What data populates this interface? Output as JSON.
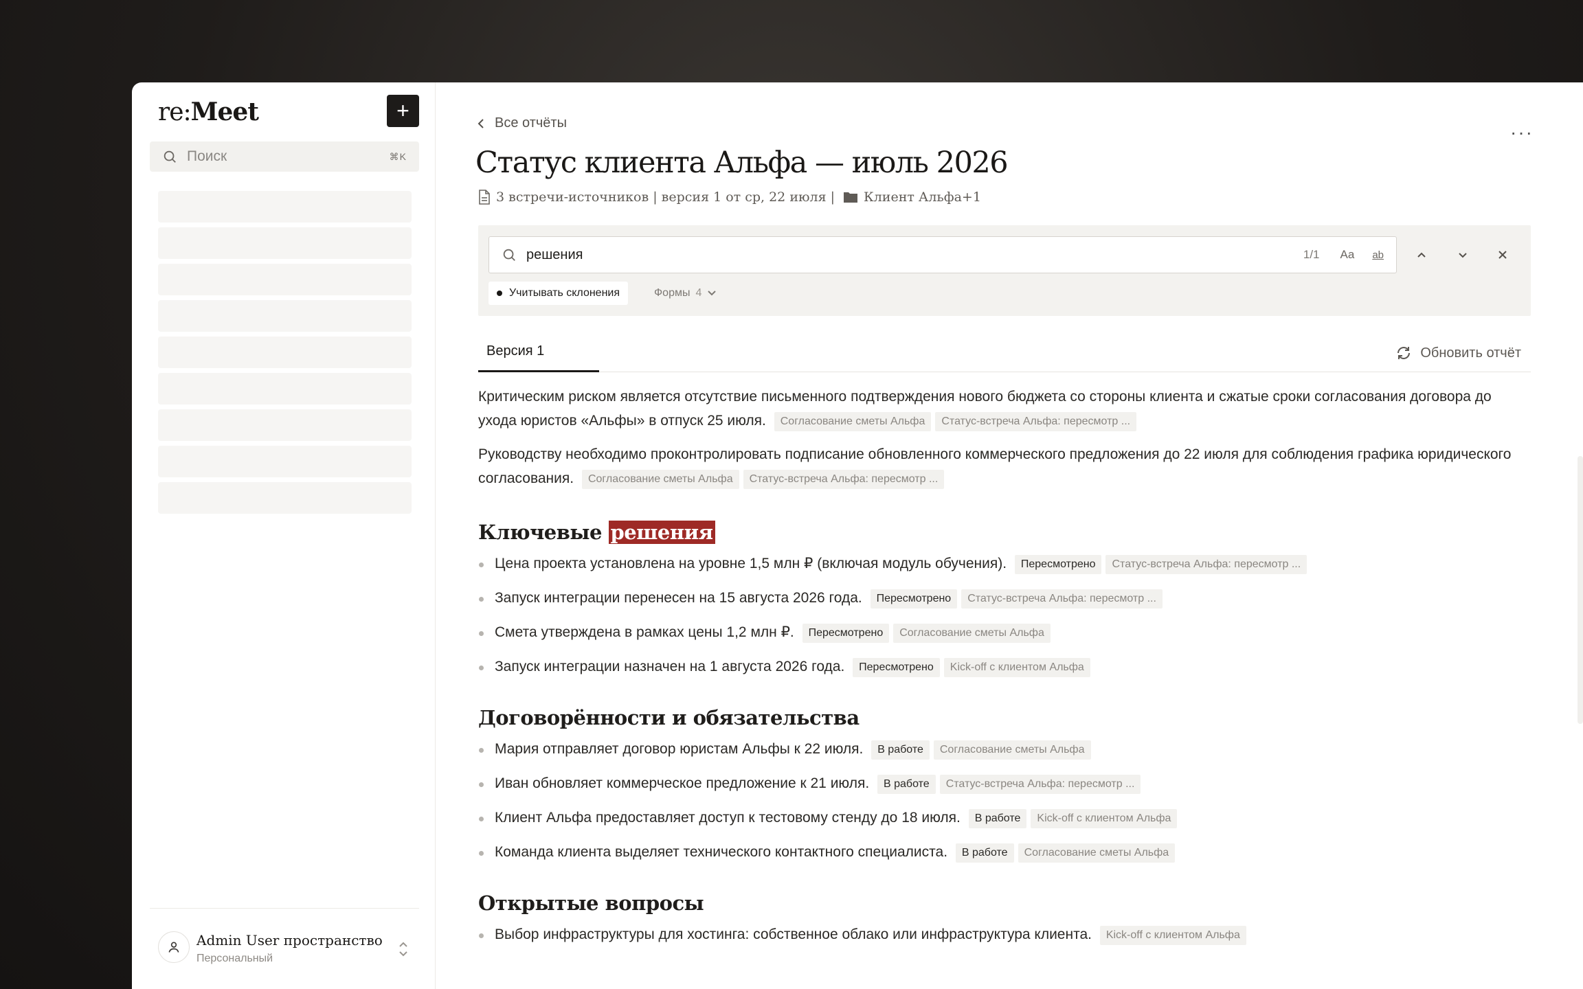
{
  "sidebar": {
    "logo_prefix": "re:",
    "logo_name": "Meet",
    "new_button": "+",
    "search": {
      "placeholder": "Поиск",
      "shortcut": "⌘K"
    },
    "user": {
      "name": "Admin User пространство",
      "subtitle": "Персональный"
    }
  },
  "report": {
    "back_label": "Все отчёты",
    "more": "···",
    "title": "Статус клиента Альфа — июль 2026",
    "meta_sources": "3 встречи-источников | версия 1 от ср, 22 июля |",
    "meta_folder": "Клиент Альфа+1"
  },
  "find": {
    "query": "решения",
    "count": "1/1",
    "case_label": "Aa",
    "word_label": "ab",
    "declension_chip": "Учитывать склонения",
    "forms_label": "Формы",
    "forms_count": "4"
  },
  "tabs": {
    "active": "Версия 1",
    "refresh": "Обновить отчёт"
  },
  "summary": [
    {
      "text": "Критическим риском является отсутствие письменного подтверждения нового бюджета со стороны клиента и сжатые сроки согласования договора до ухода юристов «Альфы» в отпуск 25 июля.",
      "tags": [
        "Согласование сметы Альфа",
        "Статус-встреча Альфа: пересмотр ..."
      ]
    },
    {
      "text": "Руководству необходимо проконтролировать подписание обновленного коммерческого предложения до 22 июля для соблюдения графика юридического согласования.",
      "tags": [
        "Согласование сметы Альфа",
        "Статус-встреча Альфа: пересмотр ..."
      ]
    }
  ],
  "decisions": {
    "heading_prefix": "Ключевые",
    "heading_match": "решения",
    "items": [
      {
        "text": "Цена проекта установлена на уровне 1,5 млн ₽ (включая модуль обучения).",
        "status": "Пересмотрено",
        "source": "Статус-встреча Альфа: пересмотр ..."
      },
      {
        "text": "Запуск интеграции перенесен на 15 августа 2026 года.",
        "status": "Пересмотрено",
        "source": "Статус-встреча Альфа: пересмотр ..."
      },
      {
        "text": "Смета утверждена в рамках цены 1,2 млн ₽.",
        "status": "Пересмотрено",
        "source": "Согласование сметы Альфа"
      },
      {
        "text": "Запуск интеграции назначен на 1 августа 2026 года.",
        "status": "Пересмотрено",
        "source": "Kick-off с клиентом Альфа"
      }
    ]
  },
  "commitments": {
    "heading": "Договорённости и обязательства",
    "items": [
      {
        "text": "Мария отправляет договор юристам Альфы к 22 июля.",
        "status": "В работе",
        "source": "Согласование сметы Альфа"
      },
      {
        "text": "Иван обновляет коммерческое предложение к 21 июля.",
        "status": "В работе",
        "source": "Статус-встреча Альфа: пересмотр ..."
      },
      {
        "text": "Клиент Альфа предоставляет доступ к тестовому стенду до 18 июля.",
        "status": "В работе",
        "source": "Kick-off с клиентом Альфа"
      },
      {
        "text": "Команда клиента выделяет технического контактного специалиста.",
        "status": "В работе",
        "source": "Согласование сметы Альфа"
      }
    ]
  },
  "open_questions": {
    "heading": "Открытые вопросы",
    "items": [
      {
        "text": "Выбор инфраструктуры для хостинга: собственное облако или инфраструктура клиента.",
        "source": "Kick-off с клиентом Альфа"
      }
    ]
  },
  "colors": {
    "highlight": "#9e2a26",
    "dark": "#1d1b19",
    "tag_bg": "#f2f1ee"
  },
  "icons": [
    "plus-icon",
    "search-icon",
    "chevron-left-icon",
    "more-icon",
    "document-icon",
    "folder-icon",
    "chevron-up-icon",
    "chevron-down-icon",
    "close-icon",
    "refresh-icon",
    "user-icon",
    "chevron-updown-icon"
  ]
}
